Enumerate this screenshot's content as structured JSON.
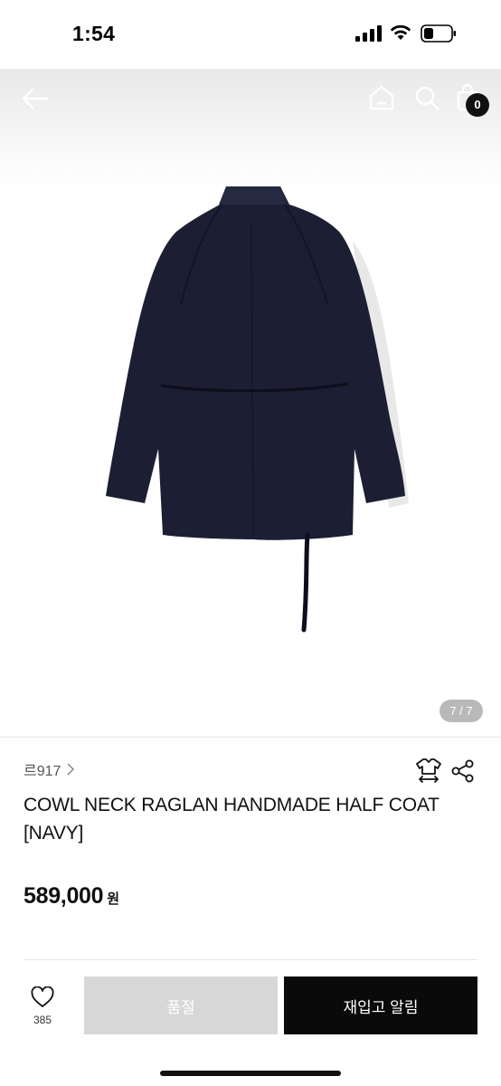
{
  "status_bar": {
    "time": "1:54"
  },
  "header": {
    "cart_count": "0"
  },
  "gallery": {
    "pager": "7 / 7"
  },
  "product": {
    "brand": "르917",
    "title": "COWL NECK RAGLAN HANDMADE HALF COAT [NAVY]",
    "price": "589,000",
    "currency": "원"
  },
  "bottom_bar": {
    "like_count": "385",
    "soldout_label": "품절",
    "restock_label": "재입고 알림"
  },
  "colors": {
    "coat": "#1c1f33",
    "primary_button": "#0a0a0a",
    "disabled_button": "#d7d7d7"
  }
}
